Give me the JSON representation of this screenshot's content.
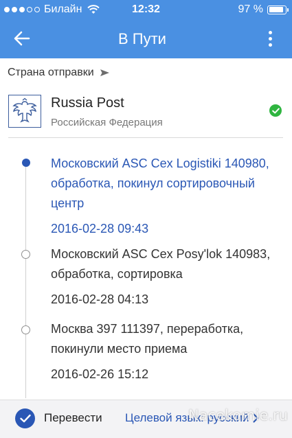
{
  "status_bar": {
    "carrier": "Билайн",
    "time": "12:32",
    "battery": "97 %"
  },
  "appbar": {
    "title": "В Пути",
    "back_icon": "arrow-left-icon",
    "more_icon": "more-vertical-icon"
  },
  "origin": {
    "label": "Страна отправки",
    "carrier_name": "Russia Post",
    "country": "Российская Федерация",
    "status_icon": "check-circle-icon",
    "status_color": "#2fb540"
  },
  "events": [
    {
      "description": "Московский ASC Cex Logistiki 140980, обработка, покинул сортировочный центр",
      "time": "2016-02-28 09:43",
      "active": true
    },
    {
      "description": "Московский ASC Cex Posy'lok 140983, обработка, сортировка",
      "time": "2016-02-28 04:13",
      "active": false
    },
    {
      "description": "Москва 397 111397, переработка, покинули место приема",
      "time": "2016-02-26 15:12",
      "active": false
    }
  ],
  "bottom": {
    "translate_label": "Перевести",
    "language_label": "Целевой язык: русский"
  },
  "watermark": "Nacekomie.ru",
  "colors": {
    "header": "#4a90e2",
    "accent": "#2a57b5"
  }
}
